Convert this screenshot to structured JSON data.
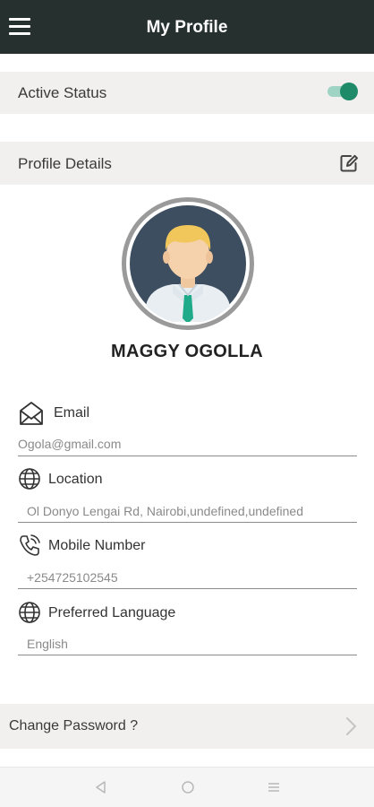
{
  "header": {
    "title": "My Profile",
    "menu_icon": "hamburger-menu-icon"
  },
  "active_status": {
    "label": "Active Status",
    "enabled": true,
    "color": "#1e8a68"
  },
  "profile_details": {
    "label": "Profile Details",
    "edit_icon": "edit-icon"
  },
  "user": {
    "name": "MAGGY OGOLLA"
  },
  "fields": {
    "email": {
      "label": "Email",
      "value": "Ogola@gmail.com",
      "icon": "envelope-icon"
    },
    "location": {
      "label": "Location",
      "value": "Ol Donyo Lengai Rd, Nairobi,undefined,undefined",
      "icon": "globe-icon"
    },
    "mobile": {
      "label": "Mobile Number",
      "value": "+254725102545",
      "icon": "phone-icon"
    },
    "language": {
      "label": "Preferred Language",
      "value": "English",
      "icon": "globe-icon"
    }
  },
  "change_password": {
    "label": "Change Password ?",
    "icon": "chevron-right-icon"
  },
  "colors": {
    "header_bg": "#26312f",
    "section_bg": "#f2f0ef",
    "accent": "#1e8a68"
  }
}
